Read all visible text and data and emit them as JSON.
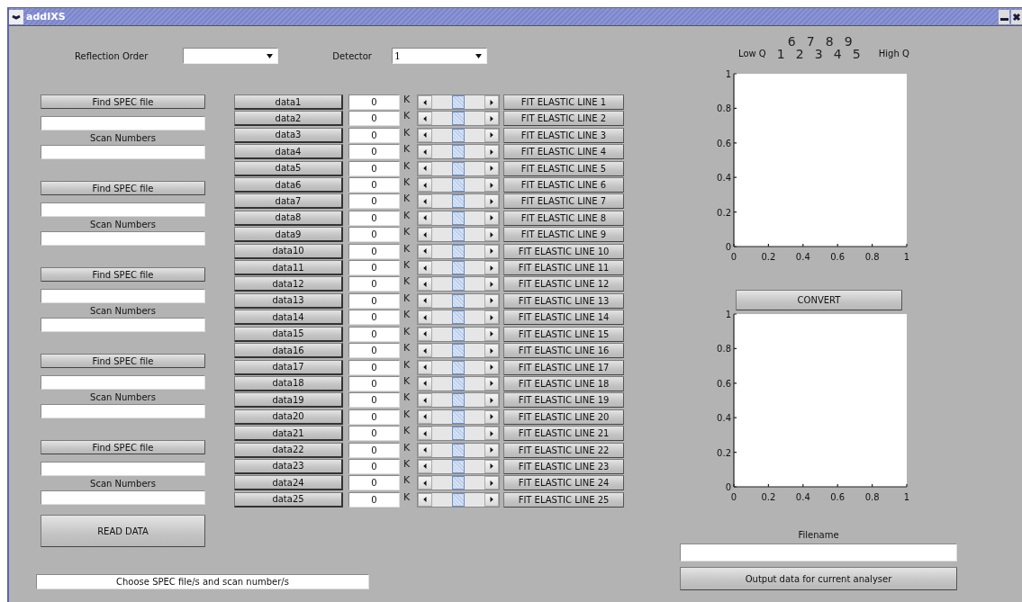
{
  "window": {
    "title": "addIXS"
  },
  "reflection_order": {
    "label": "Reflection Order"
  },
  "detector": {
    "label": "Detector",
    "value": "1"
  },
  "analyser_map": {
    "low_label": "Low Q",
    "high_label": "High Q",
    "upper_row": [
      "6",
      "7",
      "8",
      "9"
    ],
    "lower_row": [
      "1",
      "2",
      "3",
      "4",
      "5"
    ]
  },
  "spec_inputs": [
    {
      "button": "Find SPEC file",
      "scan_label": "Scan Numbers"
    },
    {
      "button": "Find SPEC file",
      "scan_label": "Scan Numbers"
    },
    {
      "button": "Find SPEC file",
      "scan_label": "Scan Numbers"
    },
    {
      "button": "Find SPEC file",
      "scan_label": "Scan Numbers"
    },
    {
      "button": "Find SPEC file",
      "scan_label": "Scan Numbers"
    }
  ],
  "read_button": "READ DATA",
  "status": "Choose SPEC file/s and scan number/s",
  "data_rows": [
    {
      "name": "data1",
      "value": "0",
      "unit": "K",
      "level": 0.5,
      "fit_button": "FIT ELASTIC LINE 1"
    },
    {
      "name": "data2",
      "value": "0",
      "unit": "K",
      "level": 0.5,
      "fit_button": "FIT ELASTIC LINE 2"
    },
    {
      "name": "data3",
      "value": "0",
      "unit": "K",
      "level": 0.5,
      "fit_button": "FIT ELASTIC LINE 3"
    },
    {
      "name": "data4",
      "value": "0",
      "unit": "K",
      "level": 0.5,
      "fit_button": "FIT ELASTIC LINE 4"
    },
    {
      "name": "data5",
      "value": "0",
      "unit": "K",
      "level": 0.5,
      "fit_button": "FIT ELASTIC LINE 5"
    },
    {
      "name": "data6",
      "value": "0",
      "unit": "K",
      "level": 0.5,
      "fit_button": "FIT ELASTIC LINE 6"
    },
    {
      "name": "data7",
      "value": "0",
      "unit": "K",
      "level": 0.5,
      "fit_button": "FIT ELASTIC LINE 7"
    },
    {
      "name": "data8",
      "value": "0",
      "unit": "K",
      "level": 0.5,
      "fit_button": "FIT ELASTIC LINE 8"
    },
    {
      "name": "data9",
      "value": "0",
      "unit": "K",
      "level": 0.5,
      "fit_button": "FIT ELASTIC LINE 9"
    },
    {
      "name": "data10",
      "value": "0",
      "unit": "K",
      "level": 0.5,
      "fit_button": "FIT ELASTIC LINE 10"
    },
    {
      "name": "data11",
      "value": "0",
      "unit": "K",
      "level": 0.5,
      "fit_button": "FIT ELASTIC LINE 11"
    },
    {
      "name": "data12",
      "value": "0",
      "unit": "K",
      "level": 0.5,
      "fit_button": "FIT ELASTIC LINE 12"
    },
    {
      "name": "data13",
      "value": "0",
      "unit": "K",
      "level": 0.5,
      "fit_button": "FIT ELASTIC LINE 13"
    },
    {
      "name": "data14",
      "value": "0",
      "unit": "K",
      "level": 0.5,
      "fit_button": "FIT ELASTIC LINE 14"
    },
    {
      "name": "data15",
      "value": "0",
      "unit": "K",
      "level": 0.5,
      "fit_button": "FIT ELASTIC LINE 15"
    },
    {
      "name": "data16",
      "value": "0",
      "unit": "K",
      "level": 0.5,
      "fit_button": "FIT ELASTIC LINE 16"
    },
    {
      "name": "data17",
      "value": "0",
      "unit": "K",
      "level": 0.5,
      "fit_button": "FIT ELASTIC LINE 17"
    },
    {
      "name": "data18",
      "value": "0",
      "unit": "K",
      "level": 0.5,
      "fit_button": "FIT ELASTIC LINE 18"
    },
    {
      "name": "data19",
      "value": "0",
      "unit": "K",
      "level": 0.5,
      "fit_button": "FIT ELASTIC LINE 19"
    },
    {
      "name": "data20",
      "value": "0",
      "unit": "K",
      "level": 0.5,
      "fit_button": "FIT ELASTIC LINE 20"
    },
    {
      "name": "data21",
      "value": "0",
      "unit": "K",
      "level": 0.5,
      "fit_button": "FIT ELASTIC LINE 21"
    },
    {
      "name": "data22",
      "value": "0",
      "unit": "K",
      "level": 0.5,
      "fit_button": "FIT ELASTIC LINE 22"
    },
    {
      "name": "data23",
      "value": "0",
      "unit": "K",
      "level": 0.5,
      "fit_button": "FIT ELASTIC LINE 23"
    },
    {
      "name": "data24",
      "value": "0",
      "unit": "K",
      "level": 0.5,
      "fit_button": "FIT ELASTIC LINE 24"
    },
    {
      "name": "data25",
      "value": "0",
      "unit": "K",
      "level": 0.5,
      "fit_button": "FIT ELASTIC LINE 25"
    }
  ],
  "plot_top": {
    "chart_data": {
      "type": "line",
      "xlim": [
        0,
        1
      ],
      "ylim": [
        0,
        1
      ],
      "xticks": [
        0,
        0.2,
        0.4,
        0.6,
        0.8,
        1
      ],
      "yticks": [
        0,
        0.2,
        0.4,
        0.6,
        0.8,
        1
      ]
    }
  },
  "convert_button": "CONVERT",
  "plot_bottom": {
    "chart_data": {
      "type": "line",
      "xlim": [
        0,
        1
      ],
      "ylim": [
        0,
        1
      ],
      "xticks": [
        0,
        0.2,
        0.4,
        0.6,
        0.8,
        1
      ],
      "yticks": [
        0,
        0.2,
        0.4,
        0.6,
        0.8,
        1
      ]
    }
  },
  "filename_label": "Filename",
  "output_button": "Output data for current analyser"
}
